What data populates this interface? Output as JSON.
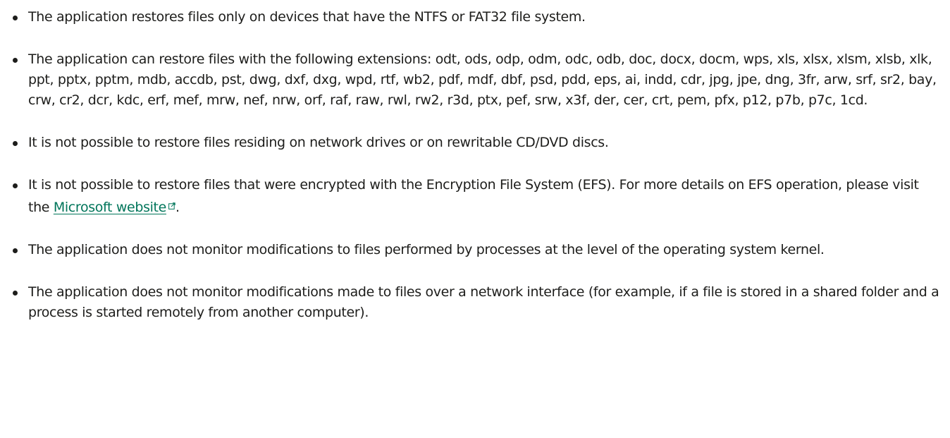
{
  "items": [
    {
      "text": "The application restores files only on devices that have the NTFS or FAT32 file system."
    },
    {
      "text": "The application can restore files with the following extensions: odt, ods, odp, odm, odc, odb, doc, docx, docm, wps, xls, xlsx, xlsm, xlsb, xlk, ppt, pptx, pptm, mdb, accdb, pst, dwg, dxf, dxg, wpd, rtf, wb2, pdf, mdf, dbf, psd, pdd, eps, ai, indd, cdr, jpg, jpe, dng, 3fr, arw, srf, sr2, bay, crw, cr2, dcr, kdc, erf, mef, mrw, nef, nrw, orf, raf, raw, rwl, rw2, r3d, ptx, pef, srw, x3f, der, cer, crt, pem, pfx, p12, p7b, p7c, 1cd."
    },
    {
      "text": "It is not possible to restore files residing on network drives or on rewritable CD/DVD discs."
    },
    {
      "text_before": "It is not possible to restore files that were encrypted with the Encryption File System (EFS). For more details on EFS operation, please visit the ",
      "link_label": "Microsoft website",
      "link_icon": "external-link-icon",
      "text_after": "."
    },
    {
      "text": "The application does not monitor modifications to files performed by processes at the level of the operating system kernel."
    },
    {
      "text": "The application does not monitor modifications made to files over a network interface (for example, if a file is stored in a shared folder and a process is started remotely from another computer)."
    }
  ],
  "colors": {
    "text": "#1d1d1b",
    "link": "#00755a"
  }
}
